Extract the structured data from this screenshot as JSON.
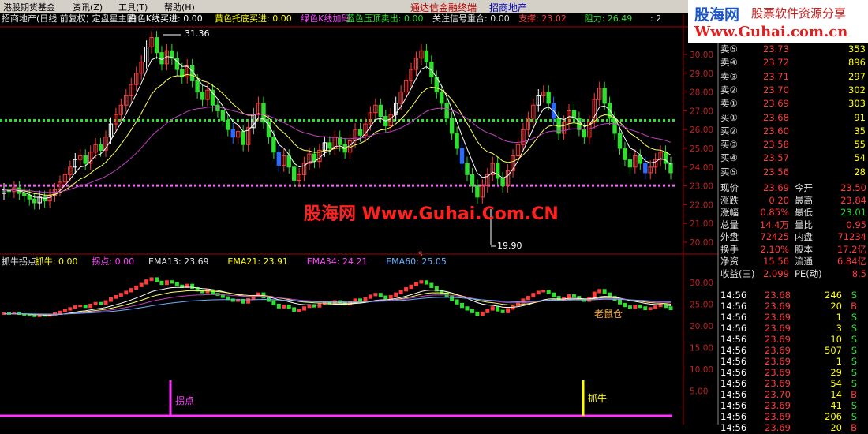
{
  "menu": {
    "items": [
      "港股期货基金",
      "资讯(Z)",
      "工具(T)",
      "帮助(H)"
    ],
    "center_title": "通达信金融终端",
    "stock": "招商地产"
  },
  "brand": {
    "name": "股海网",
    "slogan": "股票软件资源分享",
    "url": "Www.Guhai.com.cn"
  },
  "indicator_bar": [
    {
      "text": "招商地产(日线 前复权) 定盘星主图",
      "color": "#e0e0e0"
    },
    {
      "text": "白色K线买进: 0.00",
      "color": "#ffffff"
    },
    {
      "text": "黄色托底买进: 0.00",
      "color": "#ffff00"
    },
    {
      "text": "绿色K线加码",
      "color": "#ff44ff"
    },
    {
      "text": "蓝色压顶卖出: 0.00",
      "color": "#2ee02e"
    },
    {
      "text": "关注信号重合: 0.00",
      "color": "#e0e0e0"
    },
    {
      "text": "支撑: 23.02",
      "color": "#ff4040"
    },
    {
      "text": "阻力: 26.49",
      "color": "#2ee02e"
    },
    {
      "text": ": 2",
      "color": "#e0e0e0"
    }
  ],
  "sub_bar": [
    {
      "text": "抓牛拐点",
      "color": "#e0e0e0"
    },
    {
      "text": "抓牛: 0.00",
      "color": "#ffff00"
    },
    {
      "text": "拐点: 0.00",
      "color": "#ff44ff"
    },
    {
      "text": "EMA13: 23.69",
      "color": "#e0e0e0"
    },
    {
      "text": "EMA21: 23.91",
      "color": "#ffff00"
    },
    {
      "text": "EMA34: 24.21",
      "color": "#ff44ff"
    },
    {
      "text": "EMA60: 25.05",
      "color": "#6ab0ff"
    }
  ],
  "main_axis": [
    "30.00",
    "29.00",
    "28.00",
    "27.00",
    "26.00",
    "25.00",
    "24.00",
    "23.00",
    "22.00",
    "21.00",
    "20.00"
  ],
  "sub_axis": [
    "30.00",
    "25.00",
    "20.00",
    "15.00",
    "10.00",
    "5.00"
  ],
  "annotations": {
    "high": "31.36",
    "low": "19.90",
    "watermark": "股海网 Www.Guhai.Com.CN",
    "laoshucang": "老鼠仓",
    "guaidian": "拐点",
    "zhuaniu": "抓牛",
    "s_marker": "S"
  },
  "order_book": [
    {
      "label": "卖⑤",
      "price": "23.73",
      "vol": "353"
    },
    {
      "label": "卖④",
      "price": "23.72",
      "vol": "896"
    },
    {
      "label": "卖③",
      "price": "23.71",
      "vol": "297"
    },
    {
      "label": "卖②",
      "price": "23.70",
      "vol": "302"
    },
    {
      "label": "卖①",
      "price": "23.69",
      "vol": "303"
    },
    {
      "label": "买①",
      "price": "23.68",
      "vol": "91"
    },
    {
      "label": "买②",
      "price": "23.60",
      "vol": "35"
    },
    {
      "label": "买③",
      "price": "23.58",
      "vol": "55"
    },
    {
      "label": "买④",
      "price": "23.57",
      "vol": "54"
    },
    {
      "label": "买⑤",
      "price": "23.56",
      "vol": "28"
    }
  ],
  "stats": [
    {
      "l1": "现价",
      "v1": "23.69",
      "l2": "今开",
      "v2": "23.50"
    },
    {
      "l1": "涨跌",
      "v1": "0.20",
      "l2": "最高",
      "v2": "23.84"
    },
    {
      "l1": "涨幅",
      "v1": "0.85%",
      "l2": "最低",
      "v2": "23.01"
    },
    {
      "l1": "总量",
      "v1": "14.4万",
      "l2": "量比",
      "v2": "0.95"
    },
    {
      "l1": "外盘",
      "v1": "72425",
      "l2": "内盘",
      "v2": "71234"
    },
    {
      "l1": "换手",
      "v1": "2.10%",
      "l2": "股本",
      "v2": "17.2亿"
    },
    {
      "l1": "净资",
      "v1": "15.56",
      "l2": "流通",
      "v2": "6.84亿"
    },
    {
      "l1": "收益(三)",
      "v1": "2.099",
      "l2": "PE(动)",
      "v2": "8.5"
    }
  ],
  "ticks": [
    {
      "time": "14:56",
      "price": "23.68",
      "vol": "246",
      "side": "S"
    },
    {
      "time": "14:56",
      "price": "23.69",
      "vol": "20",
      "side": "B"
    },
    {
      "time": "14:56",
      "price": "23.69",
      "vol": "1",
      "side": "S"
    },
    {
      "time": "14:56",
      "price": "23.69",
      "vol": "3",
      "side": "S"
    },
    {
      "time": "14:56",
      "price": "23.69",
      "vol": "10",
      "side": "S"
    },
    {
      "time": "14:56",
      "price": "23.69",
      "vol": "507",
      "side": "S"
    },
    {
      "time": "14:56",
      "price": "23.69",
      "vol": "1",
      "side": "S"
    },
    {
      "time": "14:56",
      "price": "23.69",
      "vol": "29",
      "side": "S"
    },
    {
      "time": "14:56",
      "price": "23.69",
      "vol": "54",
      "side": "S"
    },
    {
      "time": "14:56",
      "price": "23.70",
      "vol": "14",
      "side": "B"
    },
    {
      "time": "14:56",
      "price": "23.69",
      "vol": "41",
      "side": "S"
    },
    {
      "time": "14:56",
      "price": "23.69",
      "vol": "206",
      "side": "S"
    },
    {
      "time": "14:56",
      "price": "23.69",
      "vol": "20",
      "side": "B"
    }
  ],
  "colors": {
    "up": "#ff3c3c",
    "down": "#2ee02e",
    "support": "#ff66ff",
    "resistance": "#2ee02e",
    "axis": "#b00000"
  }
}
